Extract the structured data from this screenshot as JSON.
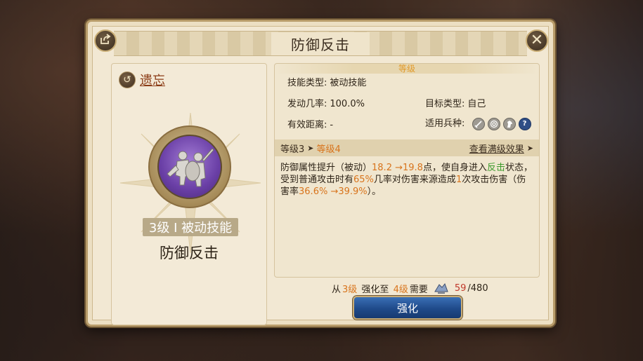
{
  "dialog": {
    "title": "防御反击",
    "forget_label": "遗忘"
  },
  "skill": {
    "level_badge": "3级 I 被动技能",
    "name": "防御反击"
  },
  "details": {
    "header_tag": "等级",
    "skill_type_label": "技能类型:",
    "skill_type_value": "被动技能",
    "trigger_rate_label": "发动几率:",
    "trigger_rate_value": "100.0%",
    "target_type_label": "目标类型:",
    "target_type_value": "自己",
    "range_label": "有效距离:",
    "range_value": "-",
    "troops_label": "适用兵种:",
    "troop_icons": [
      "sword-icon",
      "target-icon",
      "horse-icon",
      "question-icon"
    ]
  },
  "level_bar": {
    "current": "等级3",
    "next": "等级4",
    "full_effect_link": "查看满级效果"
  },
  "description": {
    "p1": "防御属性提升（被动）",
    "v1": "18.2 →19.8",
    "p2": "点，使自身进入",
    "status": "反击",
    "p3": "状态，受到普通攻击时有",
    "v2": "65%",
    "p4": "几率对伤害来源造成",
    "v3": "1",
    "p5": "次攻击伤害（伤害率",
    "v4": "36.6% →39.9%",
    "p6": "）。"
  },
  "cost": {
    "prefix": "从",
    "from_level": "3级",
    "mid": " 强化至 ",
    "to_level": "4级",
    "suffix": "需要",
    "have": "59",
    "need": "/480"
  },
  "upgrade_button_label": "强化",
  "colors": {
    "accent_orange": "#d8741c",
    "status_green": "#3c9a2c",
    "button_blue": "#1f4a8a"
  }
}
